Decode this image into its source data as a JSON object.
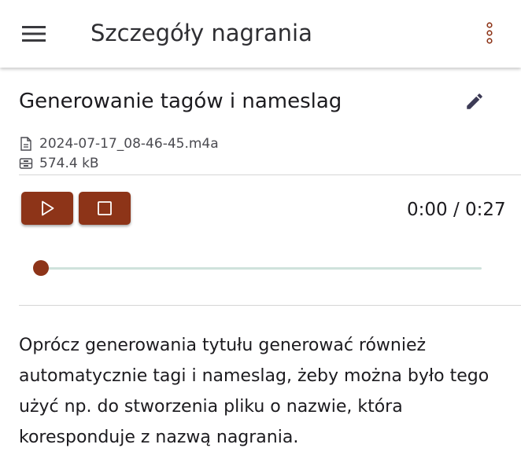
{
  "app_bar": {
    "title": "Szczegóły nagrania",
    "menu_icon": "hamburger-menu-icon",
    "more_icon": "more-vert-icon"
  },
  "recording": {
    "title": "Generowanie tagów i nameslag",
    "file_name": "2024-07-17_08-46-45.m4a",
    "file_size": "574.4 kB",
    "description": "Oprócz generowania tytułu generować również automatycznie tagi i nameslag, żeby można było tego użyć np. do stworzenia pliku o nazwie, która koresponduje z nazwą nagrania."
  },
  "player": {
    "current_time": "0:00",
    "separator": " / ",
    "total_time": "0:27",
    "progress_fraction": 0,
    "play_icon": "play-icon",
    "stop_icon": "stop-icon"
  },
  "colors": {
    "accent": "#8d3418",
    "track": "#cfe2dc"
  }
}
